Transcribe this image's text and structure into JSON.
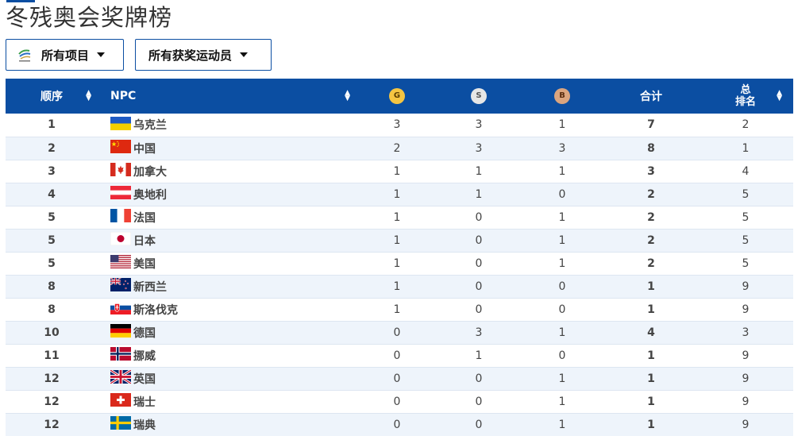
{
  "page": {
    "title": "冬残奥会奖牌榜"
  },
  "filters": {
    "events": {
      "label": "所有项目",
      "icon": "paralympics-logo-icon"
    },
    "athletes": {
      "label": "所有获奖运动员"
    }
  },
  "table": {
    "headers": {
      "order": "顺序",
      "npc": "NPC",
      "gold": "G",
      "silver": "S",
      "bronze": "B",
      "total": "合计",
      "rank_top": "总",
      "rank_bottom": "排名"
    },
    "rows": [
      {
        "order": "1",
        "npc": "乌克兰",
        "flag": "ukraine-flag-icon",
        "gold": "3",
        "silver": "3",
        "bronze": "1",
        "total": "7",
        "rank": "2"
      },
      {
        "order": "2",
        "npc": "中国",
        "flag": "china-flag-icon",
        "gold": "2",
        "silver": "3",
        "bronze": "3",
        "total": "8",
        "rank": "1"
      },
      {
        "order": "3",
        "npc": "加拿大",
        "flag": "canada-flag-icon",
        "gold": "1",
        "silver": "1",
        "bronze": "1",
        "total": "3",
        "rank": "4"
      },
      {
        "order": "4",
        "npc": "奥地利",
        "flag": "austria-flag-icon",
        "gold": "1",
        "silver": "1",
        "bronze": "0",
        "total": "2",
        "rank": "5"
      },
      {
        "order": "5",
        "npc": "法国",
        "flag": "france-flag-icon",
        "gold": "1",
        "silver": "0",
        "bronze": "1",
        "total": "2",
        "rank": "5"
      },
      {
        "order": "5",
        "npc": "日本",
        "flag": "japan-flag-icon",
        "gold": "1",
        "silver": "0",
        "bronze": "1",
        "total": "2",
        "rank": "5"
      },
      {
        "order": "5",
        "npc": "美国",
        "flag": "usa-flag-icon",
        "gold": "1",
        "silver": "0",
        "bronze": "1",
        "total": "2",
        "rank": "5"
      },
      {
        "order": "8",
        "npc": "新西兰",
        "flag": "new-zealand-flag-icon",
        "gold": "1",
        "silver": "0",
        "bronze": "0",
        "total": "1",
        "rank": "9"
      },
      {
        "order": "8",
        "npc": "斯洛伐克",
        "flag": "slovakia-flag-icon",
        "gold": "1",
        "silver": "0",
        "bronze": "0",
        "total": "1",
        "rank": "9"
      },
      {
        "order": "10",
        "npc": "德国",
        "flag": "germany-flag-icon",
        "gold": "0",
        "silver": "3",
        "bronze": "1",
        "total": "4",
        "rank": "3"
      },
      {
        "order": "11",
        "npc": "挪威",
        "flag": "norway-flag-icon",
        "gold": "0",
        "silver": "1",
        "bronze": "0",
        "total": "1",
        "rank": "9"
      },
      {
        "order": "12",
        "npc": "英国",
        "flag": "uk-flag-icon",
        "gold": "0",
        "silver": "0",
        "bronze": "1",
        "total": "1",
        "rank": "9"
      },
      {
        "order": "12",
        "npc": "瑞士",
        "flag": "switzerland-flag-icon",
        "gold": "0",
        "silver": "0",
        "bronze": "1",
        "total": "1",
        "rank": "9"
      },
      {
        "order": "12",
        "npc": "瑞典",
        "flag": "sweden-flag-icon",
        "gold": "0",
        "silver": "0",
        "bronze": "1",
        "total": "1",
        "rank": "9"
      }
    ]
  },
  "colors": {
    "header_bg": "#0b4ea2",
    "row_alt": "#eef4fb",
    "gold": "#f5c542",
    "silver": "#e6e6e6",
    "bronze": "#dba57f"
  }
}
